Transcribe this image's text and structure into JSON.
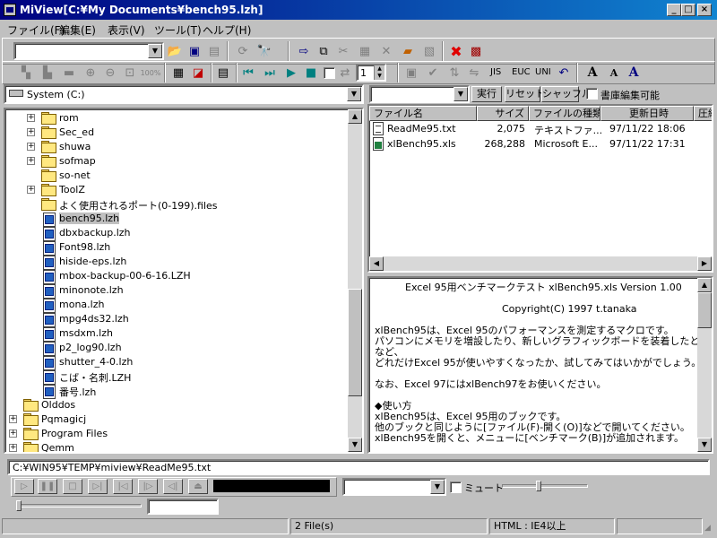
{
  "window": {
    "title": "MiView[C:¥My Documents¥bench95.lzh]",
    "minimize": "_",
    "maximize": "□",
    "close": "×"
  },
  "menu": [
    "ファイル(F)",
    "編集(E)",
    "表示(V)",
    "ツール(T)",
    "ヘルプ(H)"
  ],
  "toolbar2": {
    "zoom_label": "100%",
    "page_value": "1",
    "jis": "JIS",
    "euc": "EUC",
    "uni": "UNI"
  },
  "drive": {
    "label": "System (C:)"
  },
  "tree": [
    {
      "label": "rom",
      "type": "folder",
      "expander": "+",
      "level": 1
    },
    {
      "label": "Sec_ed",
      "type": "folder",
      "expander": "+",
      "level": 1
    },
    {
      "label": "shuwa",
      "type": "folder",
      "expander": "+",
      "level": 1
    },
    {
      "label": "sofmap",
      "type": "folder",
      "expander": "+",
      "level": 1
    },
    {
      "label": "so-net",
      "type": "folder",
      "expander": "",
      "level": 1
    },
    {
      "label": "ToolZ",
      "type": "folder",
      "expander": "+",
      "level": 1
    },
    {
      "label": "よく使用されるポート(0-199).files",
      "type": "folder",
      "expander": "",
      "level": 1
    },
    {
      "label": "bench95.lzh",
      "type": "lzh",
      "expander": "",
      "level": 1,
      "selected": true
    },
    {
      "label": "dbxbackup.lzh",
      "type": "lzh",
      "expander": "",
      "level": 1
    },
    {
      "label": "Font98.lzh",
      "type": "lzh",
      "expander": "",
      "level": 1
    },
    {
      "label": "hiside-eps.lzh",
      "type": "lzh",
      "expander": "",
      "level": 1
    },
    {
      "label": "mbox-backup-00-6-16.LZH",
      "type": "lzh",
      "expander": "",
      "level": 1
    },
    {
      "label": "minonote.lzh",
      "type": "lzh",
      "expander": "",
      "level": 1
    },
    {
      "label": "mona.lzh",
      "type": "lzh",
      "expander": "",
      "level": 1
    },
    {
      "label": "mpg4ds32.lzh",
      "type": "lzh",
      "expander": "",
      "level": 1
    },
    {
      "label": "msdxm.lzh",
      "type": "lzh",
      "expander": "",
      "level": 1
    },
    {
      "label": "p2_log90.lzh",
      "type": "lzh",
      "expander": "",
      "level": 1
    },
    {
      "label": "shutter_4-0.lzh",
      "type": "lzh",
      "expander": "",
      "level": 1
    },
    {
      "label": "こば・名刺.LZH",
      "type": "lzh",
      "expander": "",
      "level": 1
    },
    {
      "label": "番号.lzh",
      "type": "lzh",
      "expander": "",
      "level": 1
    },
    {
      "label": "Olddos",
      "type": "folder",
      "expander": "",
      "level": 0
    },
    {
      "label": "Pqmagicj",
      "type": "folder",
      "expander": "+",
      "level": 0
    },
    {
      "label": "Program Files",
      "type": "folder",
      "expander": "+",
      "level": 0
    },
    {
      "label": "Qemm",
      "type": "folder",
      "expander": "+",
      "level": 0
    }
  ],
  "filter": {
    "run": "実行",
    "reset": "リセット",
    "shuffle": "シャッフル",
    "bookshelf": "書庫編集可能"
  },
  "filelist": {
    "columns": [
      "ファイル名",
      "サイズ",
      "ファイルの種類",
      "更新日時",
      "圧縮"
    ],
    "rows": [
      {
        "name": "ReadMe95.txt",
        "size": "2,075",
        "type": "テキストファ...",
        "date": "97/11/22 18:06",
        "icon": "txt"
      },
      {
        "name": "xlBench95.xls",
        "size": "268,288",
        "type": "Microsoft E...",
        "date": "97/11/22 17:31",
        "icon": "xls"
      }
    ]
  },
  "preview": {
    "lines": [
      "Excel 95用ベンチマークテスト  xlBench95.xls  Version 1.00",
      "",
      "Copyright(C) 1997 t.tanaka",
      "",
      " xlBench95は、Excel 95のパフォーマンスを測定するマクロです。",
      "  パソコンにメモリを増設したり、新しいグラフィックボードを装着したとき",
      "など、",
      "  どれだけExcel 95が使いやすくなったか、試してみてはいかがでしょう。",
      "",
      "  なお、Excel 97にはxlBench97をお使いください。",
      "",
      "◆使い方",
      "  xlBench95は、Excel 95用のブックです。",
      "  他のブックと同じように[ファイル(F)-開く(O)]などで開いてください。",
      "  xlBench95を開くと、メニューに[ベンチマーク(B)]が追加されます。"
    ]
  },
  "path": "C:¥WIN95¥TEMP¥miview¥ReadMe95.txt",
  "player": {
    "mute": "ミュート"
  },
  "status": {
    "left": "",
    "files": "2 File(s)",
    "html": "HTML : IE4以上",
    "right": ""
  }
}
